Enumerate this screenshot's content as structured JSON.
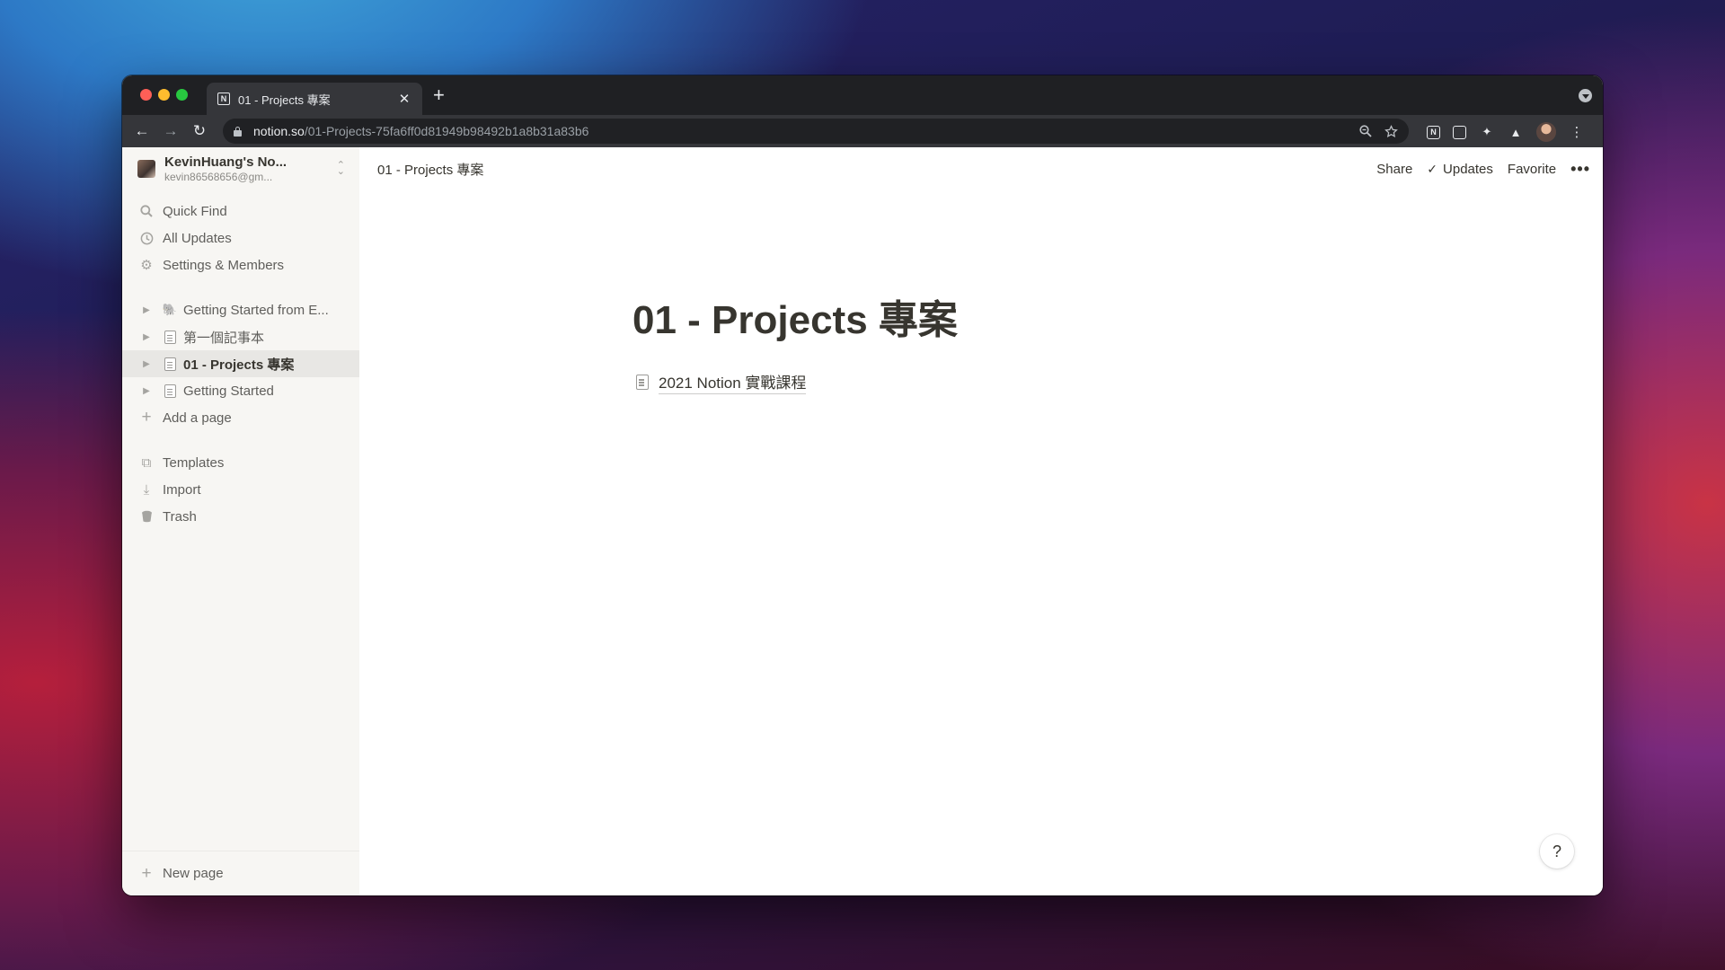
{
  "browser": {
    "tab": {
      "favicon": "N",
      "title": "01 - Projects 專案",
      "close": "✕"
    },
    "new_tab": "+",
    "nav": {
      "back": "←",
      "forward": "→",
      "reload": "↻"
    },
    "url": {
      "host": "notion.so",
      "path": "/01-Projects-75fa6ff0d81949b98492b1a8b31a83b6"
    },
    "omni_icons": {
      "zoom": "zoom-icon",
      "bookmark": "star-icon"
    },
    "extensions": {
      "notion": "N",
      "other": "◩",
      "puzzle": "✦",
      "labs": "▲",
      "menu": "⋮"
    }
  },
  "sidebar": {
    "workspace": {
      "name": "KevinHuang's No...",
      "email": "kevin86568656@gm...",
      "switcher": "⌃⌄"
    },
    "nav": [
      {
        "label": "Quick Find",
        "icon": "search-icon",
        "glyph": "⌕"
      },
      {
        "label": "All Updates",
        "icon": "clock-icon",
        "glyph": "◷"
      },
      {
        "label": "Settings & Members",
        "icon": "gear-icon",
        "glyph": "⚙"
      }
    ],
    "pages": [
      {
        "label": "Getting Started from E...",
        "icon": "elephant-icon",
        "glyph": "🐘"
      },
      {
        "label": "第一個記事本",
        "icon": "page-icon"
      },
      {
        "label": "01 - Projects 專案",
        "icon": "page-icon"
      },
      {
        "label": "Getting Started",
        "icon": "page-icon"
      }
    ],
    "toggle": "▶",
    "add_page": {
      "label": "Add a page",
      "glyph": "+"
    },
    "tools": [
      {
        "label": "Templates",
        "icon": "templates-icon",
        "glyph": "⧉"
      },
      {
        "label": "Import",
        "icon": "import-icon",
        "glyph": "⤓"
      },
      {
        "label": "Trash",
        "icon": "trash-icon",
        "glyph": "🗑"
      }
    ],
    "new_page": {
      "label": "New page",
      "glyph": "+"
    }
  },
  "topbar": {
    "breadcrumb": "01 - Projects 專案",
    "share": "Share",
    "updates": "Updates",
    "updates_check": "✓",
    "favorite": "Favorite",
    "more": "•••"
  },
  "page": {
    "title": "01 - Projects 專案",
    "subpages": [
      {
        "label": "2021 Notion 實戰課程"
      }
    ]
  },
  "help": "?"
}
